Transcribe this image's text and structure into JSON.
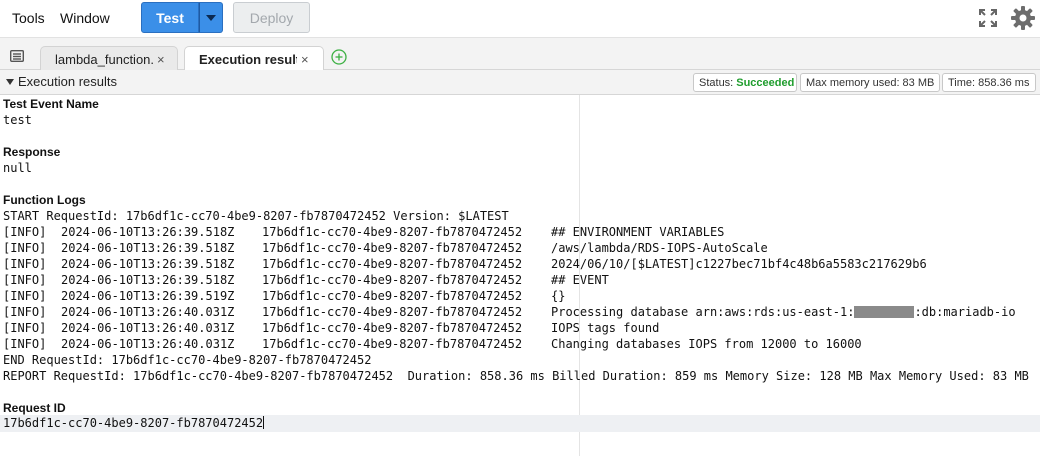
{
  "menu": {
    "tools": "Tools",
    "window": "Window"
  },
  "toolbar": {
    "test_label": "Test",
    "deploy_label": "Deploy"
  },
  "tabs": [
    {
      "label": "lambda_function.",
      "close": "×"
    },
    {
      "label": "Execution results",
      "close": "×"
    }
  ],
  "results": {
    "title": "Execution results",
    "status_label": "Status:",
    "status_value": "Succeeded",
    "memory_label": "Max memory used:",
    "memory_value": "83 MB",
    "time_label": "Time:",
    "time_value": "858.36 ms",
    "status_color": "#1f9d2d"
  },
  "sections": {
    "test_event_label": "Test Event Name",
    "test_event_value": "test",
    "response_label": "Response",
    "response_value": "null",
    "logs_label": "Function Logs",
    "request_id_label": "Request ID",
    "request_id_value": "17b6df1c-cc70-4be9-8207-fb7870472452"
  },
  "logs": {
    "start_line": "START RequestId: 17b6df1c-cc70-4be9-8207-fb7870472452 Version: $LATEST",
    "entries": [
      {
        "level": "[INFO]",
        "ts": "2024-06-10T13:26:39.518Z",
        "req": "17b6df1c-cc70-4be9-8207-fb7870472452",
        "msg": "## ENVIRONMENT VARIABLES"
      },
      {
        "level": "[INFO]",
        "ts": "2024-06-10T13:26:39.518Z",
        "req": "17b6df1c-cc70-4be9-8207-fb7870472452",
        "msg": "/aws/lambda/RDS-IOPS-AutoScale"
      },
      {
        "level": "[INFO]",
        "ts": "2024-06-10T13:26:39.518Z",
        "req": "17b6df1c-cc70-4be9-8207-fb7870472452",
        "msg": "2024/06/10/[$LATEST]c1227bec71bf4c48b6a5583c217629b6"
      },
      {
        "level": "[INFO]",
        "ts": "2024-06-10T13:26:39.518Z",
        "req": "17b6df1c-cc70-4be9-8207-fb7870472452",
        "msg": "## EVENT"
      },
      {
        "level": "[INFO]",
        "ts": "2024-06-10T13:26:39.519Z",
        "req": "17b6df1c-cc70-4be9-8207-fb7870472452",
        "msg": "{}"
      },
      {
        "level": "[INFO]",
        "ts": "2024-06-10T13:26:40.031Z",
        "req": "17b6df1c-cc70-4be9-8207-fb7870472452",
        "msg_pre": "Processing database arn:aws:rds:us-east-1:",
        "msg_post": ":db:mariadb-io"
      },
      {
        "level": "[INFO]",
        "ts": "2024-06-10T13:26:40.031Z",
        "req": "17b6df1c-cc70-4be9-8207-fb7870472452",
        "msg": "IOPS tags found"
      },
      {
        "level": "[INFO]",
        "ts": "2024-06-10T13:26:40.031Z",
        "req": "17b6df1c-cc70-4be9-8207-fb7870472452",
        "msg": "Changing databases IOPS from 12000 to 16000"
      }
    ],
    "end_line": "END RequestId: 17b6df1c-cc70-4be9-8207-fb7870472452",
    "report_line": "REPORT RequestId: 17b6df1c-cc70-4be9-8207-fb7870472452  Duration: 858.36 ms Billed Duration: 859 ms Memory Size: 128 MB Max Memory Used: 83 MB"
  },
  "icons": {
    "fullscreen": "fullscreen-icon",
    "settings": "gear-icon",
    "files": "file-list-icon",
    "add_tab": "plus-circle-icon",
    "collapse": "triangle-down-icon"
  }
}
